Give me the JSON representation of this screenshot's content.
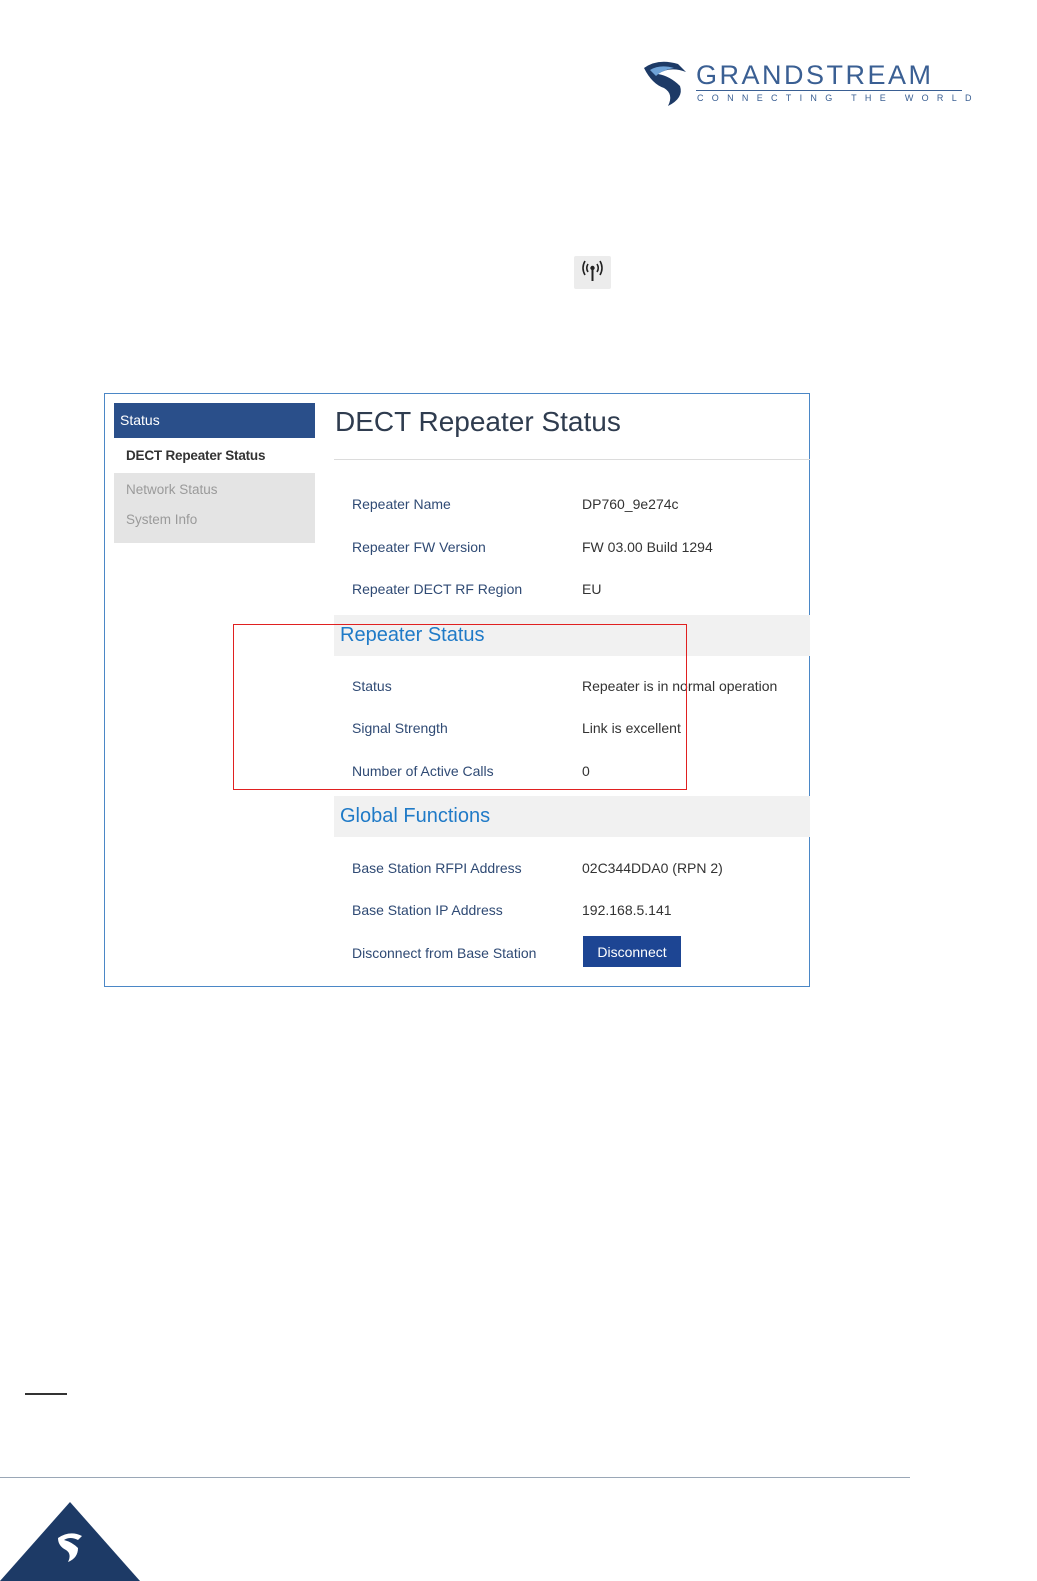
{
  "brand": {
    "name": "GRANDSTREAM",
    "tagline": "CONNECTING THE WORLD",
    "colors": {
      "primary": "#3a5f93",
      "dark": "#1d3a66"
    }
  },
  "inline_icon": {
    "icon": "signal-antenna-icon"
  },
  "sidebar": {
    "header": "Status",
    "items": [
      {
        "label": "DECT Repeater Status",
        "active": true
      },
      {
        "label": "Network Status",
        "active": false
      },
      {
        "label": "System Info",
        "active": false
      }
    ]
  },
  "main": {
    "title": "DECT Repeater Status",
    "info_rows": [
      {
        "label": "Repeater Name",
        "value": "DP760_9e274c"
      },
      {
        "label": "Repeater FW Version",
        "value": "FW 03.00 Build 1294"
      },
      {
        "label": "Repeater DECT RF Region",
        "value": "EU"
      }
    ],
    "repeater_status": {
      "title": "Repeater Status",
      "rows": [
        {
          "label": "Status",
          "value": "Repeater is in normal operation"
        },
        {
          "label": "Signal Strength",
          "value": "Link is excellent"
        },
        {
          "label": "Number of Active Calls",
          "value": "0"
        }
      ]
    },
    "global_functions": {
      "title": "Global Functions",
      "rows": [
        {
          "label": "Base Station RFPI Address",
          "value": "02C344DDA0 (RPN 2)"
        },
        {
          "label": "Base Station IP Address",
          "value": "192.168.5.141"
        },
        {
          "label": "Disconnect from Base Station"
        }
      ],
      "disconnect_label": "Disconnect"
    }
  },
  "colors": {
    "accent_blue": "#1f7ac7",
    "sidebar_header": "#2a4f8a",
    "button": "#1d4593",
    "highlight": "#e02020"
  }
}
